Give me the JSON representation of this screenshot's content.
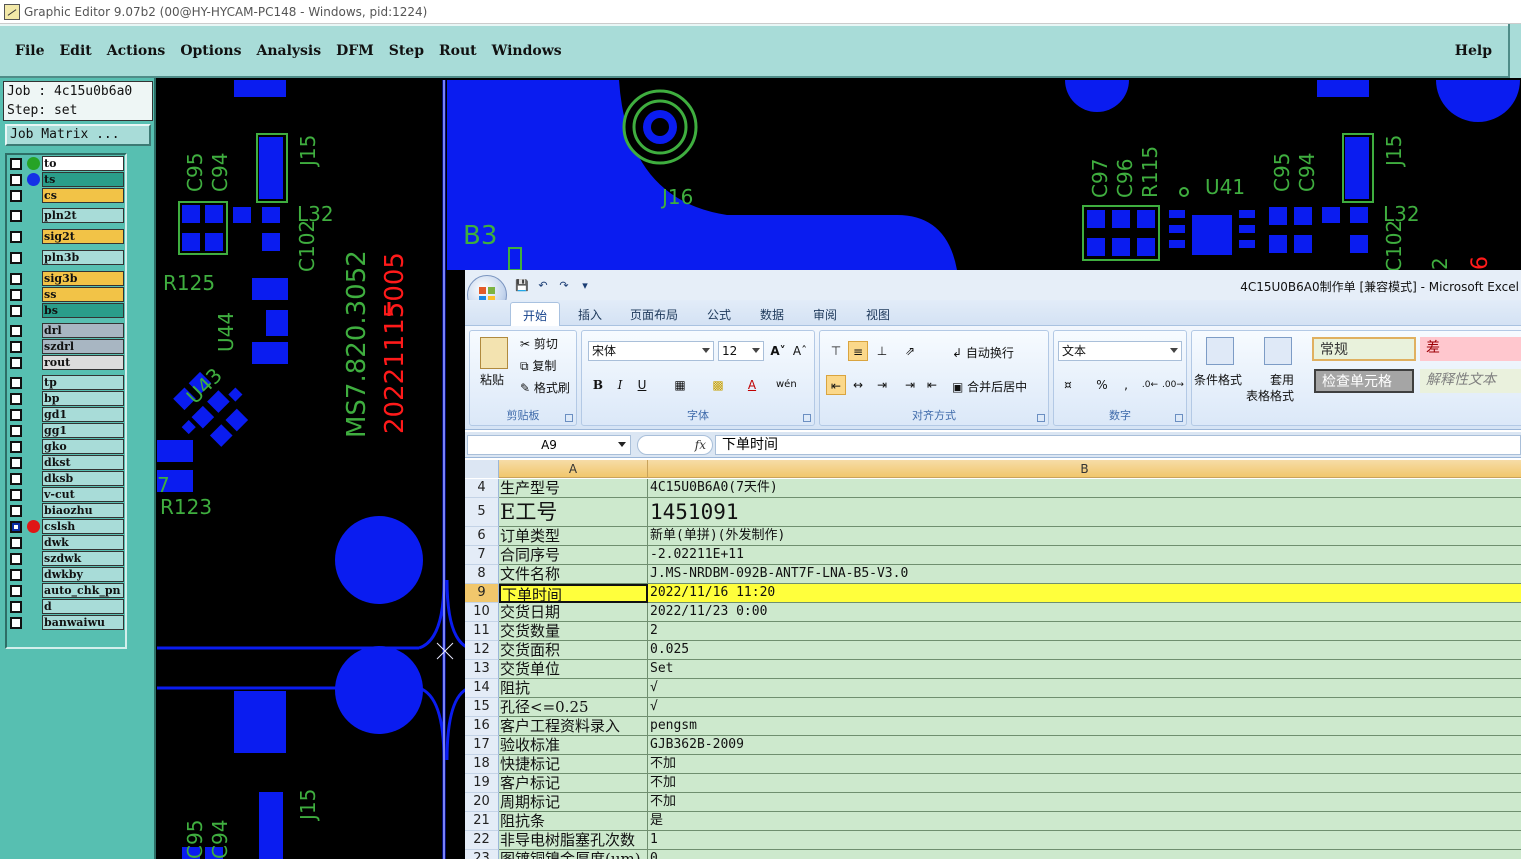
{
  "window_title": "Graphic Editor 9.07b2 (00@HY-HYCAM-PC148 - Windows, pid:1224)",
  "menu": [
    "File",
    "Edit",
    "Actions",
    "Options",
    "Analysis",
    "DFM",
    "Step",
    "Rout",
    "Windows"
  ],
  "help_label": "Help",
  "job": {
    "job_line": "Job : 4c15u0b6a0",
    "step_line": "Step: set",
    "matrix_button": "Job Matrix ..."
  },
  "layers": [
    {
      "name": "to",
      "color": "#ffffff",
      "dot": "#26a326",
      "active": false
    },
    {
      "name": "ts",
      "color": "#2a9d8a",
      "dot": "#1530e6",
      "active": false
    },
    {
      "name": "cs",
      "color": "#f2c347",
      "dot": "",
      "active": false
    },
    {
      "name": "pln2t",
      "color": "#a8dcd8",
      "dot": "",
      "active": false
    },
    {
      "name": "sig2t",
      "color": "#f2c347",
      "dot": "",
      "active": false
    },
    {
      "name": "pln3b",
      "color": "#a8dcd8",
      "dot": "",
      "active": false
    },
    {
      "name": "sig3b",
      "color": "#f2c347",
      "dot": "",
      "active": false
    },
    {
      "name": "ss",
      "color": "#f2c347",
      "dot": "",
      "active": false
    },
    {
      "name": "bs",
      "color": "#2a9d8a",
      "dot": "",
      "active": false
    },
    {
      "name": "drl",
      "color": "#a8b6c2",
      "dot": "",
      "active": false
    },
    {
      "name": "szdrl",
      "color": "#a8b6c2",
      "dot": "",
      "active": false
    },
    {
      "name": "rout",
      "color": "#dcdcdc",
      "dot": "",
      "active": false
    },
    {
      "name": "tp",
      "color": "#a8dcd8",
      "dot": "",
      "active": false
    },
    {
      "name": "bp",
      "color": "#a8dcd8",
      "dot": "",
      "active": false
    },
    {
      "name": "gd1",
      "color": "#a8dcd8",
      "dot": "",
      "active": false
    },
    {
      "name": "gg1",
      "color": "#a8dcd8",
      "dot": "",
      "active": false
    },
    {
      "name": "gko",
      "color": "#a8dcd8",
      "dot": "",
      "active": false
    },
    {
      "name": "dkst",
      "color": "#a8dcd8",
      "dot": "",
      "active": false
    },
    {
      "name": "dksb",
      "color": "#a8dcd8",
      "dot": "",
      "active": false
    },
    {
      "name": "v-cut",
      "color": "#a8dcd8",
      "dot": "",
      "active": false
    },
    {
      "name": "biaozhu",
      "color": "#a8dcd8",
      "dot": "",
      "active": false
    },
    {
      "name": "cslsh",
      "color": "#a8dcd8",
      "dot": "#e01616",
      "active": true
    },
    {
      "name": "dwk",
      "color": "#a8dcd8",
      "dot": "",
      "active": false
    },
    {
      "name": "szdwk",
      "color": "#a8dcd8",
      "dot": "",
      "active": false
    },
    {
      "name": "dwkby",
      "color": "#a8dcd8",
      "dot": "",
      "active": false
    },
    {
      "name": "auto_chk_pn",
      "color": "#a8dcd8",
      "dot": "",
      "active": false
    },
    {
      "name": "d",
      "color": "#a8dcd8",
      "dot": "",
      "active": false
    },
    {
      "name": "banwaiwu",
      "color": "#a8dcd8",
      "dot": "",
      "active": false
    }
  ],
  "pcb_labels": {
    "c95": "C95",
    "c94": "C94",
    "j15": "J15",
    "l32": "L32",
    "c102": "C102",
    "r125": "R125",
    "u44": "U44",
    "u43": "U43",
    "r123": "R123",
    "seven": "7",
    "ms": "MS7.820.3052",
    "date": "20221115005",
    "j16": "J16",
    "b3": "B3",
    "c97": "C97",
    "c96": "C96",
    "r115": "R115",
    "u41": "U41",
    "c95b": "C95",
    "c94b": "C94",
    "j15b": "J15",
    "l32b": "L32",
    "c102b": "C102",
    "edge2": "2",
    "edge6": "6",
    "c95c": "C95",
    "c94c": "C94",
    "j15c": "J15"
  },
  "excel": {
    "caption": "4C15U0B6A0制作单  [兼容模式] - Microsoft Excel",
    "tabs": [
      "开始",
      "插入",
      "页面布局",
      "公式",
      "数据",
      "审阅",
      "视图"
    ],
    "ribbon": {
      "paste": "粘贴",
      "cut": "剪切",
      "copy": "复制",
      "format_painter": "格式刷",
      "clipboard": "剪贴板",
      "font_name": "宋体",
      "font_size": "12",
      "font_group": "字体",
      "wrap": "自动换行",
      "merge": "合并后居中",
      "align_group": "对齐方式",
      "number_format": "文本",
      "number_group": "数字",
      "cond_format": "条件格式",
      "table_format_1": "套用",
      "table_format_2": "表格格式",
      "style_normal": "常规",
      "style_bad": "差",
      "style_check": "检查单元格",
      "style_explain": "解释性文本",
      "bold": "B",
      "italic": "I",
      "underline": "U",
      "percent": "%",
      "comma": ","
    },
    "name_box": "A9",
    "fx": "fx",
    "formula": "下单时间",
    "col_headers": [
      "A",
      "B"
    ],
    "rows": [
      {
        "n": "4",
        "a": "生产型号",
        "b": "4C15U0B6A0(7天件)"
      },
      {
        "n": "5",
        "a": "E工号",
        "b": "1451091"
      },
      {
        "n": "6",
        "a": "订单类型",
        "b": "新单(单拼)(外发制作)"
      },
      {
        "n": "7",
        "a": "合同序号",
        "b": "-2.02211E+11"
      },
      {
        "n": "8",
        "a": "文件名称",
        "b": "J.MS-NRDBM-092B-ANT7F-LNA-B5-V3.0"
      },
      {
        "n": "9",
        "a": "下单时间",
        "b": "2022/11/16  11:20"
      },
      {
        "n": "10",
        "a": "交货日期",
        "b": "2022/11/23  0:00"
      },
      {
        "n": "11",
        "a": "交货数量",
        "b": "2"
      },
      {
        "n": "12",
        "a": "交货面积",
        "b": "0.025"
      },
      {
        "n": "13",
        "a": "交货单位",
        "b": "Set"
      },
      {
        "n": "14",
        "a": "阻抗",
        "b": "√"
      },
      {
        "n": "15",
        "a": "孔径<=0.25",
        "b": "√"
      },
      {
        "n": "16",
        "a": "客户工程资料录入",
        "b": "pengsm"
      },
      {
        "n": "17",
        "a": "验收标准",
        "b": "GJB362B-2009"
      },
      {
        "n": "18",
        "a": "快捷标记",
        "b": "不加"
      },
      {
        "n": "19",
        "a": "客户标记",
        "b": "不加"
      },
      {
        "n": "20",
        "a": "周期标记",
        "b": "不加"
      },
      {
        "n": "21",
        "a": "阻抗条",
        "b": "是"
      },
      {
        "n": "22",
        "a": "非导电树脂塞孔次数",
        "b": "1"
      },
      {
        "n": "23",
        "a": "图镀铜镍金厚度(um)",
        "b": "0"
      }
    ]
  }
}
